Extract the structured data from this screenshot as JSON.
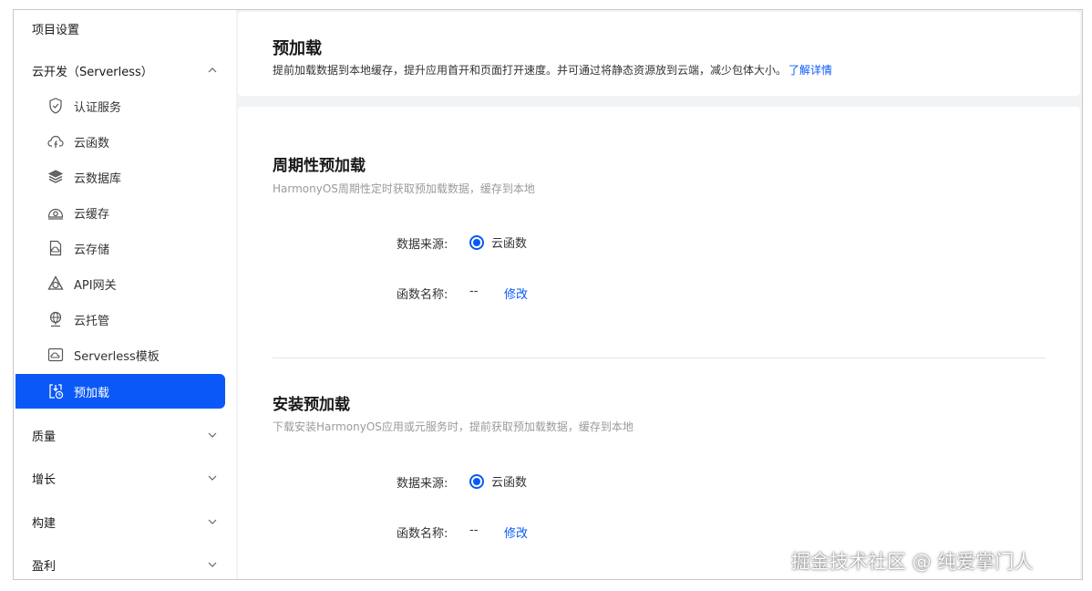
{
  "sidebar": {
    "header": "项目设置",
    "serverless_group": {
      "label": "云开发（Serverless）",
      "expanded": true
    },
    "items": [
      {
        "label": "认证服务",
        "icon": "shield-check-icon"
      },
      {
        "label": "云函数",
        "icon": "cloud-function-icon"
      },
      {
        "label": "云数据库",
        "icon": "database-layers-icon"
      },
      {
        "label": "云缓存",
        "icon": "cloud-cache-icon"
      },
      {
        "label": "云存储",
        "icon": "cloud-storage-icon"
      },
      {
        "label": "API网关",
        "icon": "api-gateway-icon"
      },
      {
        "label": "云托管",
        "icon": "globe-hosting-icon"
      },
      {
        "label": "Serverless模板",
        "icon": "template-icon"
      },
      {
        "label": "预加载",
        "icon": "preload-icon",
        "active": true
      }
    ],
    "groups": [
      {
        "label": "质量",
        "expanded": false
      },
      {
        "label": "增长",
        "expanded": false
      },
      {
        "label": "构建",
        "expanded": false
      },
      {
        "label": "盈利",
        "expanded": false
      }
    ]
  },
  "header": {
    "title": "预加载",
    "description": "提前加载数据到本地缓存，提升应用首开和页面打开速度。并可通过将静态资源放到云端，减少包体大小。",
    "learn_more": "了解详情"
  },
  "periodic": {
    "title": "周期性预加载",
    "description": "HarmonyOS周期性定时获取预加载数据，缓存到本地",
    "source_label": "数据来源:",
    "source_value": "云函数",
    "function_label": "函数名称:",
    "function_value": "--",
    "edit": "修改"
  },
  "install": {
    "title": "安装预加载",
    "description": "下载安装HarmonyOS应用或元服务时，提前获取预加载数据，缓存到本地",
    "source_label": "数据来源:",
    "source_value": "云函数",
    "function_label": "函数名称:",
    "function_value": "--",
    "edit": "修改"
  },
  "watermark": "掘金技术社区 @ 纯爱掌门人",
  "colors": {
    "accent": "#0a59f7",
    "page_bg": "#f1f3f5"
  }
}
